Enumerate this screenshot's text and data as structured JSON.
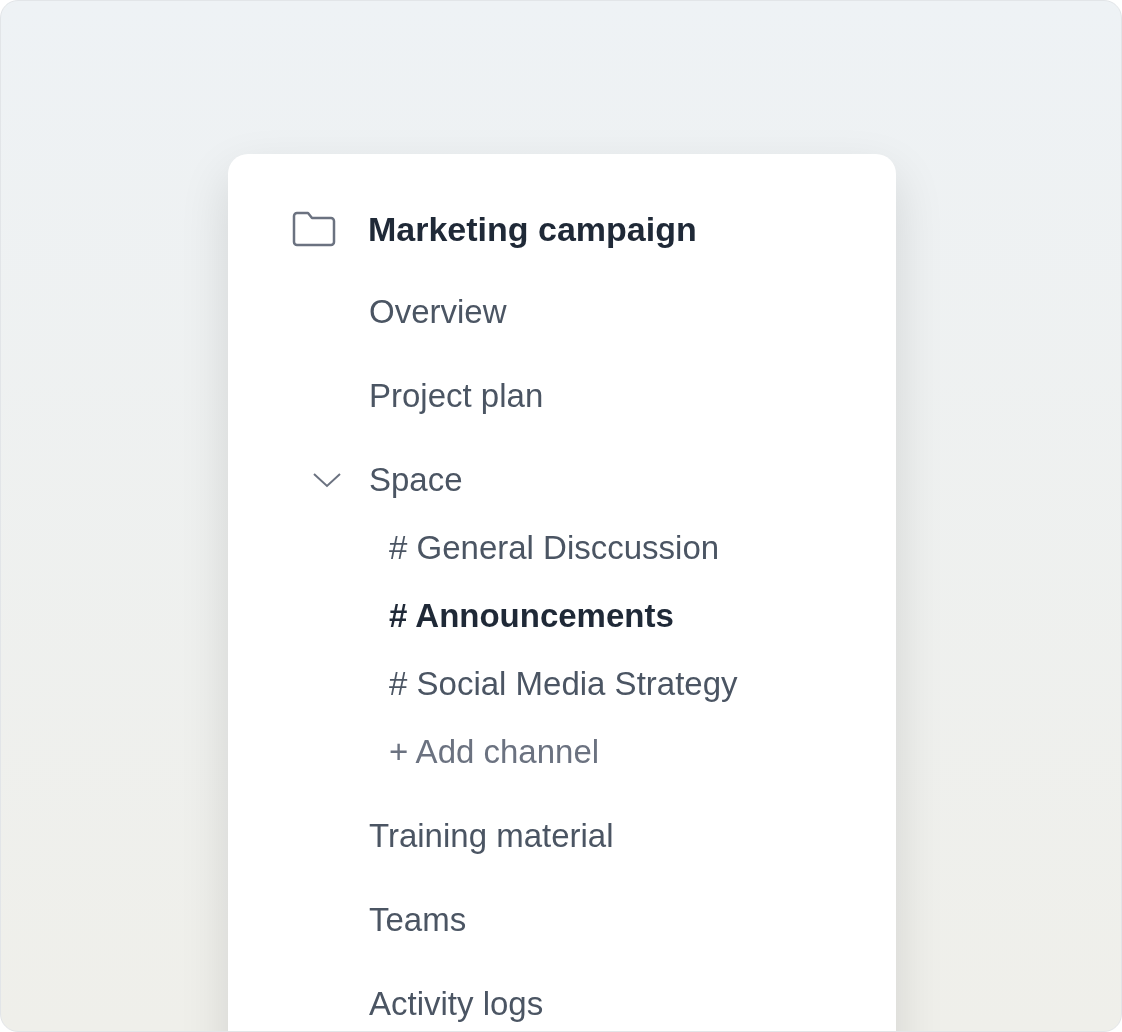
{
  "folder": {
    "title": "Marketing campaign"
  },
  "items": [
    {
      "label": "Overview"
    },
    {
      "label": "Project plan"
    },
    {
      "label": "Space",
      "expanded": true,
      "children": [
        {
          "label": "# General Disccussion",
          "selected": false
        },
        {
          "label": "# Announcements",
          "selected": true
        },
        {
          "label": "# Social Media Strategy",
          "selected": false
        }
      ],
      "add_label": "+ Add channel"
    },
    {
      "label": "Training material"
    },
    {
      "label": "Teams"
    },
    {
      "label": "Activity logs"
    }
  ]
}
